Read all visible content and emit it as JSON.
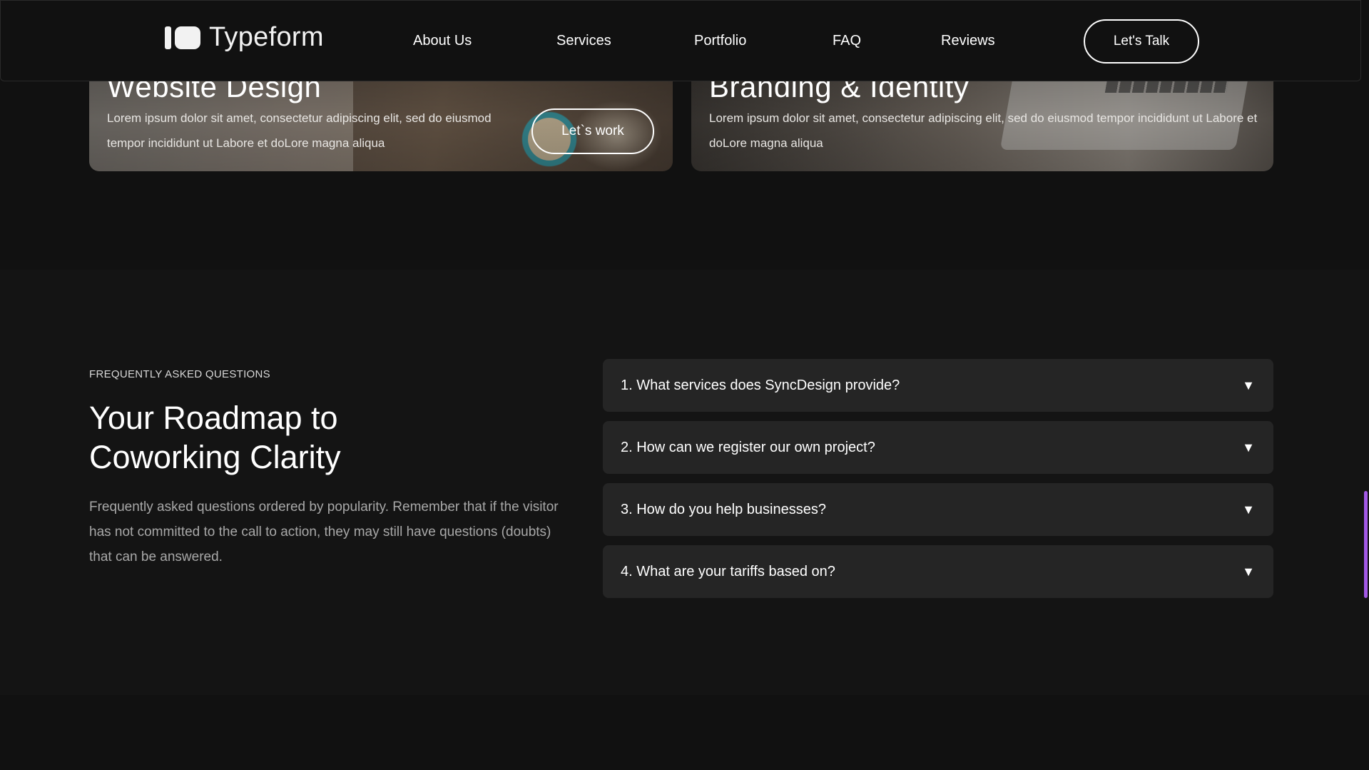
{
  "header": {
    "logo_text": "Typeform",
    "nav": [
      {
        "label": "About Us"
      },
      {
        "label": "Services"
      },
      {
        "label": "Portfolio"
      },
      {
        "label": "FAQ"
      },
      {
        "label": "Reviews"
      }
    ],
    "cta_label": "Let's Talk"
  },
  "services": {
    "cards": [
      {
        "title": "Website Design",
        "text": "Lorem ipsum dolor sit amet, consectetur adipiscing elit, sed do eiusmod tempor incididunt ut Labore et doLore magna aliqua",
        "button_label": "Let`s work"
      },
      {
        "title": "Branding & Identity",
        "text": "Lorem ipsum dolor sit amet, consectetur adipiscing elit, sed do eiusmod tempor incididunt ut Labore et doLore magna aliqua"
      }
    ]
  },
  "faq": {
    "eyebrow": "FREQUENTLY ASKED QUESTIONS",
    "heading": "Your Roadmap to Coworking Clarity",
    "description": "Frequently asked questions ordered by popularity. Remember that if the visitor has not committed to the call to action, they may still have questions (doubts) that can be answered.",
    "items": [
      {
        "question": "1. What services does SyncDesign provide?",
        "icon": "triangle-down-icon"
      },
      {
        "question": "2. How can we register our own project?",
        "icon": "triangle-down-icon"
      },
      {
        "question": "3. How do you help businesses?",
        "icon": "triangle-down-icon"
      },
      {
        "question": "4. What are your tariffs based on?",
        "icon": "triangle-down-icon"
      }
    ],
    "arrow_glyph": "▼"
  },
  "colors": {
    "background": "#111111",
    "faq_item_bg": "#252525",
    "scrollbar_accent": "#a259e6"
  }
}
